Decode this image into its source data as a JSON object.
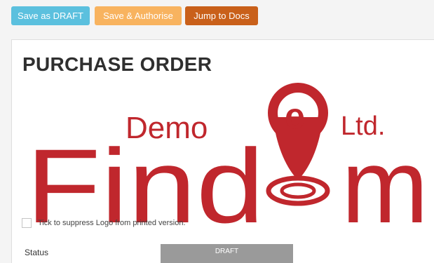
{
  "toolbar": {
    "save_draft_label": "Save as DRAFT",
    "save_authorise_label": "Save & Authorise",
    "jump_docs_label": "Jump to Docs"
  },
  "page": {
    "title": "PURCHASE ORDER"
  },
  "logo": {
    "word_demo": "Demo",
    "word_ltd": "Ltd.",
    "word_main_left": "Find",
    "word_main_right": "m",
    "pin_letter": "e",
    "color": "#c0272d"
  },
  "suppress_logo": {
    "label": "Tick to suppress Logo from printed version.",
    "checked": false
  },
  "status": {
    "label": "Status",
    "value": "DRAFT"
  },
  "colors": {
    "draft_button": "#5bc0de",
    "authorise_button": "#f8b35f",
    "docs_button": "#c9601a",
    "status_badge": "#9a9a9a",
    "logo_red": "#c0272d"
  }
}
